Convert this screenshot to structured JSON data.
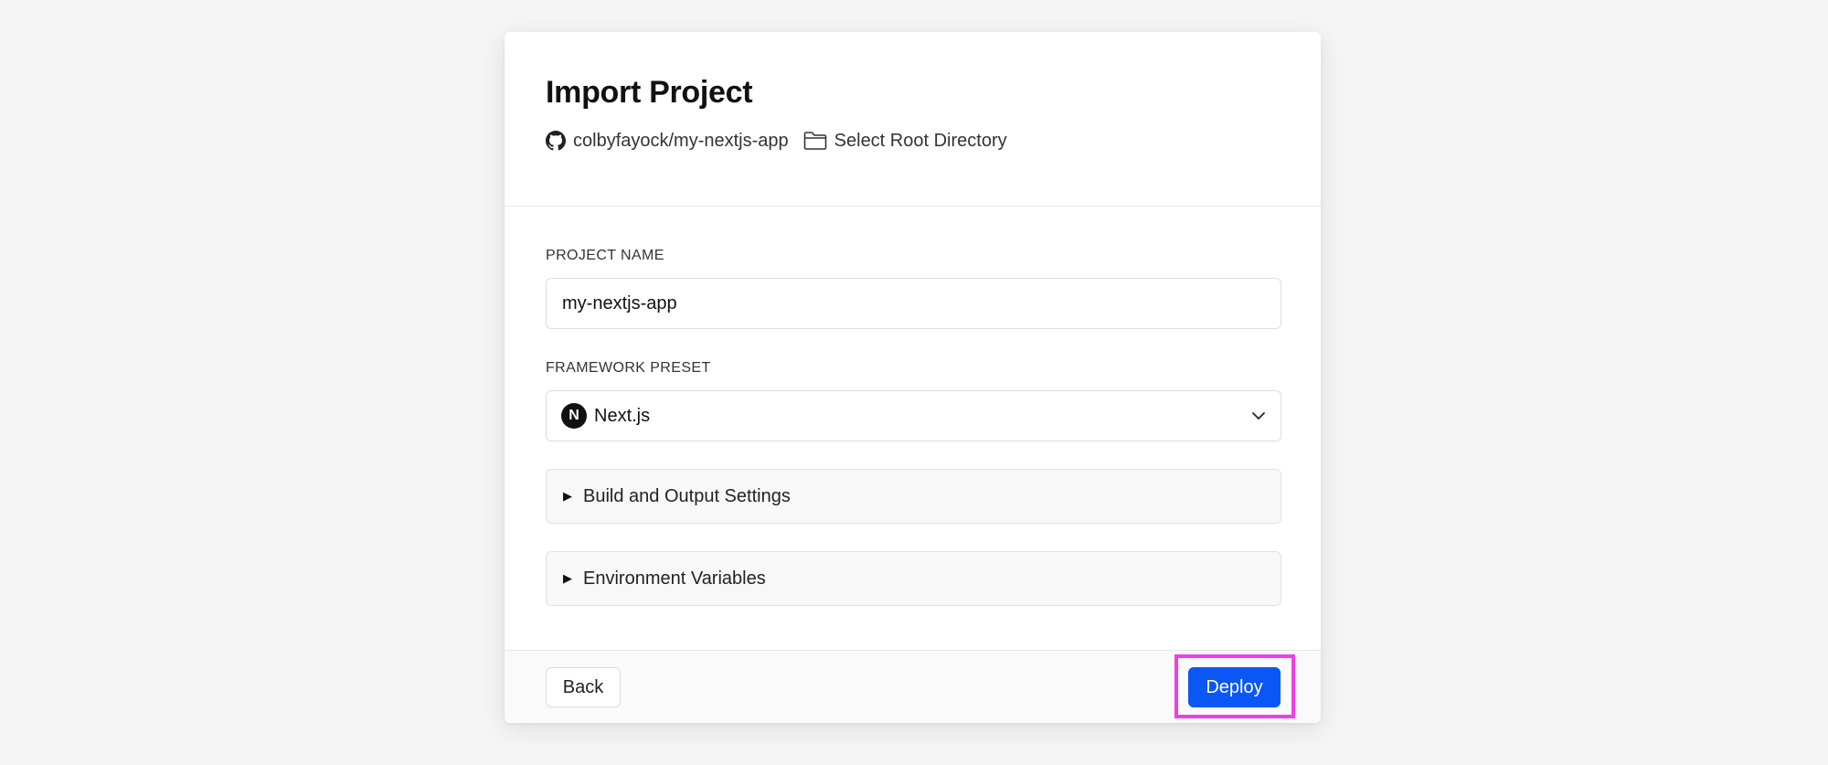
{
  "header": {
    "title": "Import Project",
    "repo": {
      "icon": "github-icon",
      "label": "colbyfayock/my-nextjs-app"
    },
    "root_directory": {
      "icon": "folder-icon",
      "label": "Select Root Directory"
    }
  },
  "form": {
    "project_name": {
      "label": "PROJECT NAME",
      "value": "my-nextjs-app"
    },
    "framework_preset": {
      "label": "FRAMEWORK PRESET",
      "selected": "Next.js",
      "icon": "nextjs-logo-icon",
      "logo_letter": "N",
      "dropdown_icon": "chevron-down-icon"
    },
    "sections": [
      {
        "label": "Build and Output Settings",
        "icon": "triangle-right-icon",
        "expanded": false
      },
      {
        "label": "Environment Variables",
        "icon": "triangle-right-icon",
        "expanded": false
      }
    ]
  },
  "footer": {
    "back_label": "Back",
    "deploy_label": "Deploy"
  },
  "colors": {
    "page_background": "#f5f5f5",
    "card_background": "#ffffff",
    "deploy_button": "#0b57f5",
    "highlight": "#ef3fe6"
  }
}
